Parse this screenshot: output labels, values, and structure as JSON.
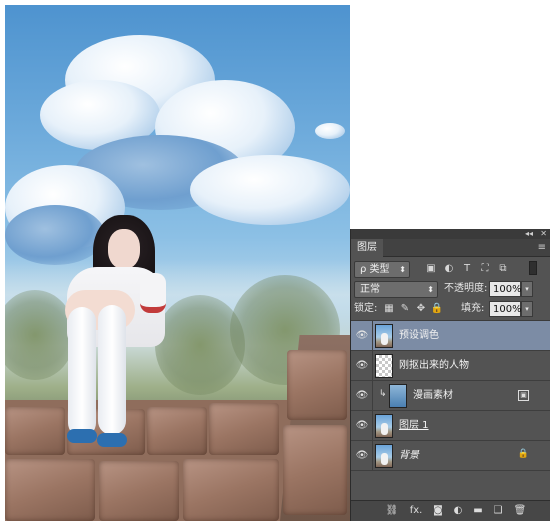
{
  "panel": {
    "tab_label": "图层",
    "collapse_glyph": "◂◂",
    "close_glyph": "✕",
    "menu_glyph": "≡"
  },
  "filter": {
    "kind_label": "ρ 类型",
    "arrow": "⬍",
    "icons": [
      "image-filter-icon",
      "adjustment-filter-icon",
      "type-filter-icon",
      "shape-filter-icon",
      "smart-object-filter-icon"
    ]
  },
  "blend": {
    "mode_value": "正常",
    "arrow": "⬍",
    "opacity_label": "不透明度:",
    "opacity_value": "100%",
    "opacity_arrow": "▾"
  },
  "lock": {
    "label": "锁定:",
    "fill_label": "填充:",
    "fill_value": "100%",
    "fill_arrow": "▾"
  },
  "layers": [
    {
      "name": "预设调色",
      "selected": true,
      "thumb": "photo",
      "italic": false,
      "underline": false
    },
    {
      "name": "刚抠出来的人物",
      "selected": false,
      "thumb": "check",
      "italic": false,
      "underline": false
    },
    {
      "name": "漫画素材",
      "selected": false,
      "thumb": "adjust",
      "italic": false,
      "underline": false,
      "clipped": true,
      "smart_object": true
    },
    {
      "name": "图层 1",
      "selected": false,
      "thumb": "photo",
      "italic": false,
      "underline": true
    },
    {
      "name": "背景",
      "selected": false,
      "thumb": "photo",
      "italic": true,
      "underline": false,
      "locked": true
    }
  ],
  "bottom_icons": [
    "link-layers-icon",
    "fx-icon",
    "add-mask-icon",
    "new-adjustment-icon",
    "new-group-icon",
    "new-layer-icon",
    "delete-layer-icon"
  ],
  "bottom_glyphs": {
    "link": "⛓",
    "fx": "fx.",
    "mask": "◙",
    "adjust": "◐",
    "group": "▬",
    "new": "❑",
    "delete": "🗑"
  },
  "glyphs": {
    "eye": "👁",
    "clip": "↳",
    "smart": "▣",
    "lock": "🔒"
  }
}
